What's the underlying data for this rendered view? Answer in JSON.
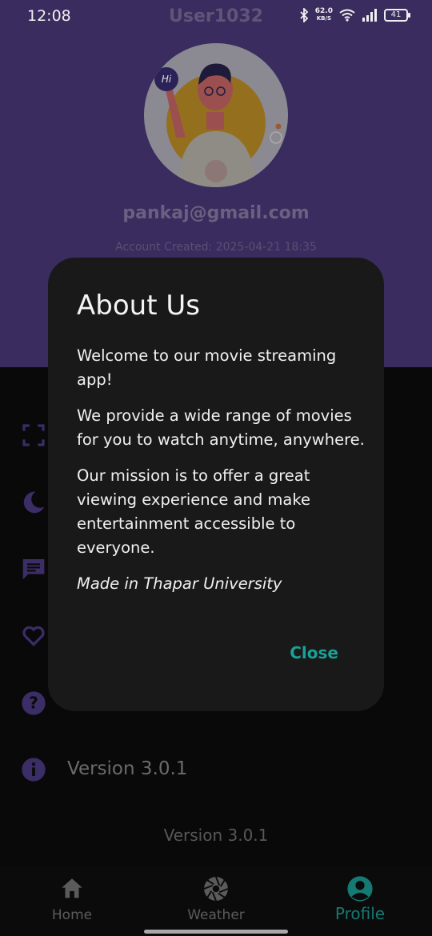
{
  "status_bar": {
    "time": "12:08",
    "title": "User1032",
    "net_speed_value": "62.0",
    "net_speed_unit": "KB/S",
    "battery": "41"
  },
  "profile": {
    "avatar_badge": "Hi",
    "email": "pankaj@gmail.com",
    "account_created": "Account Created: 2025-04-21 18:35"
  },
  "menu": {
    "icons": [
      "fullscreen-icon",
      "moon-icon",
      "message-icon",
      "heart-icon",
      "help-icon",
      "info-icon"
    ],
    "version_label": "Version 3.0.1"
  },
  "footer": {
    "version": "Version 3.0.1"
  },
  "dialog": {
    "title": "About Us",
    "paragraph_1": "Welcome to our movie streaming app!",
    "paragraph_2": "We provide a wide range of movies for you to watch anytime, anywhere.",
    "paragraph_3": "Our mission is to offer a great viewing experience and make entertainment accessible to everyone.",
    "paragraph_4": "Made in Thapar University",
    "close_label": "Close"
  },
  "bottom_nav": {
    "items": [
      {
        "label": "Home",
        "icon": "home-icon"
      },
      {
        "label": "Weather",
        "icon": "aperture-icon"
      },
      {
        "label": "Profile",
        "icon": "account-circle-icon"
      }
    ],
    "active": "Profile"
  },
  "colors": {
    "header": "#3a2c5e",
    "accent_icon": "#3b2d66",
    "close_text": "#1aa196",
    "active_nav": "#157a73"
  }
}
